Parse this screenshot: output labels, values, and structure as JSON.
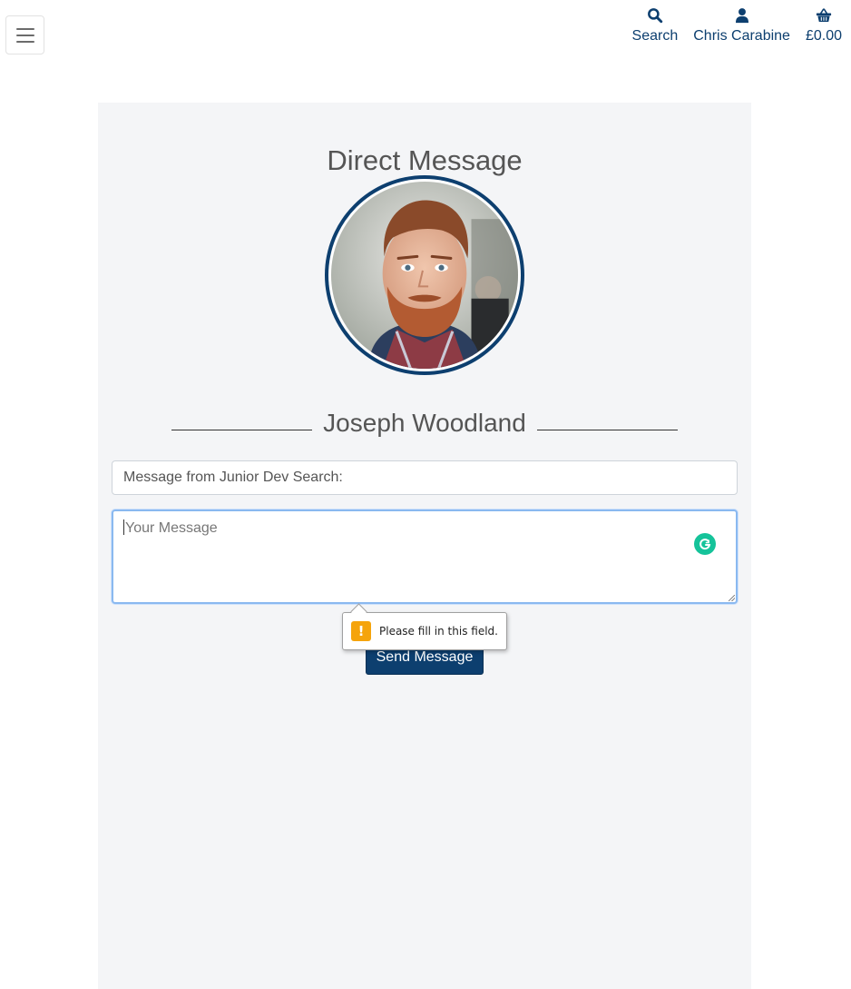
{
  "nav": {
    "search_label": "Search",
    "account_label": "Chris Carabine",
    "basket_total": "£0.00",
    "menu_icon": "hamburger-icon",
    "search_icon": "search-icon",
    "account_icon": "user-icon",
    "basket_icon": "basket-icon"
  },
  "page": {
    "title": "Direct Message",
    "recipient_name": "Joseph Woodland"
  },
  "form": {
    "subject_value": "Message from Junior Dev Search:",
    "message_placeholder": "Your Message",
    "message_value": "",
    "send_label": "Send Message"
  },
  "validation": {
    "message": "Please fill in this field.",
    "icon": "warning-icon"
  },
  "colors": {
    "brand": "#0d3f6f",
    "panel_bg": "#f4f5f7",
    "grammarly": "#15c39a",
    "warning": "#f5a40c"
  }
}
